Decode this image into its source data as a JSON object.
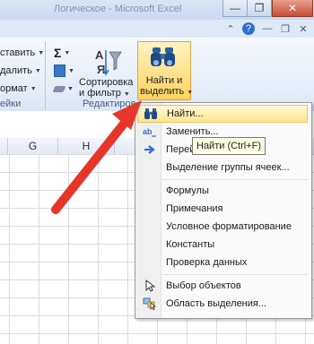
{
  "title_bar": {
    "title": "Логическое - Microsoft Excel",
    "window_buttons": [
      "minimize",
      "restore",
      "close"
    ]
  },
  "tab_icons": [
    "chevron-up-icon",
    "help-icon",
    "minimize-ribbon-icon",
    "restore-ribbon-icon",
    "close-workbook-icon"
  ],
  "ribbon": {
    "cells_group": {
      "insert_label": "ставить",
      "delete_label": "далить",
      "format_label": "ормат",
      "group_label": "ейки"
    },
    "editing_group": {
      "sort_label_line1": "Сортировка",
      "sort_label_line2": "и фильтр",
      "find_label_line1": "Найти и",
      "find_label_line2": "выделить",
      "group_label": "Редактиров"
    }
  },
  "columns": [
    "G",
    "H"
  ],
  "menu": {
    "items": [
      {
        "label": "Найти...",
        "icon": "binoculars-icon",
        "highlighted": true
      },
      {
        "label": "Заменить...",
        "icon": "replace-icon",
        "highlighted": false
      },
      {
        "label": "Перейти...",
        "icon": "goto-arrow-icon",
        "highlighted": false
      },
      {
        "label": "Выделение группы ячеек...",
        "icon": "",
        "highlighted": false
      },
      {
        "label": "Формулы",
        "icon": "",
        "highlighted": false
      },
      {
        "label": "Примечания",
        "icon": "",
        "highlighted": false
      },
      {
        "label": "Условное форматирование",
        "icon": "",
        "highlighted": false
      },
      {
        "label": "Константы",
        "icon": "",
        "highlighted": false
      },
      {
        "label": "Проверка данных",
        "icon": "",
        "highlighted": false
      },
      {
        "label": "Выбор объектов",
        "icon": "select-objects-icon",
        "highlighted": false
      },
      {
        "label": "Область выделения...",
        "icon": "selection-pane-icon",
        "highlighted": false
      }
    ]
  },
  "tooltip": "Найти (Ctrl+F)",
  "colors": {
    "annotation_arrow": "#e8352a",
    "highlight": "#ffe58a"
  }
}
